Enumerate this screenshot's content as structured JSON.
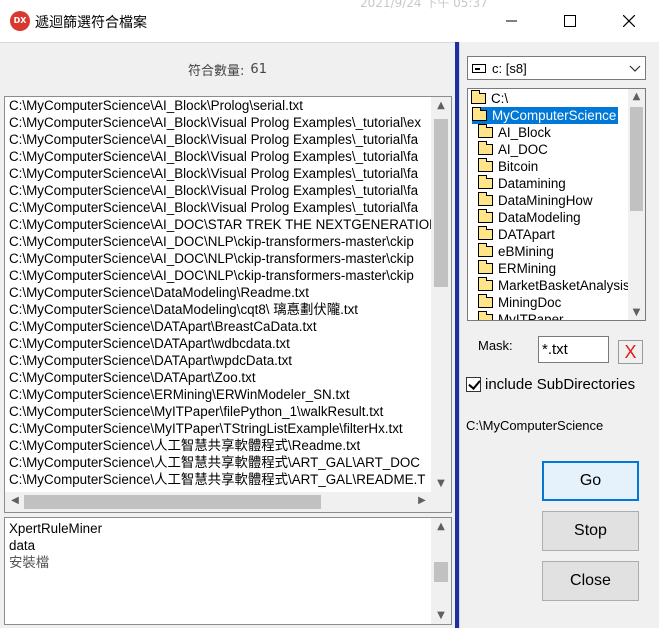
{
  "window": {
    "app_icon_text": "DX",
    "title": "遞迴篩選符合檔案",
    "background_text": "2021/9/24 下午 05:37",
    "minimize_label": "—",
    "maximize_label": "☐",
    "close_label": "✕"
  },
  "results": {
    "count_label": "符合數量:",
    "count_value": "61",
    "files": [
      "C:\\MyComputerScience\\AI_Block\\Prolog\\serial.txt",
      "C:\\MyComputerScience\\AI_Block\\Visual Prolog Examples\\_tutorial\\ex",
      "C:\\MyComputerScience\\AI_Block\\Visual Prolog Examples\\_tutorial\\fa",
      "C:\\MyComputerScience\\AI_Block\\Visual Prolog Examples\\_tutorial\\fa",
      "C:\\MyComputerScience\\AI_Block\\Visual Prolog Examples\\_tutorial\\fa",
      "C:\\MyComputerScience\\AI_Block\\Visual Prolog Examples\\_tutorial\\fa",
      "C:\\MyComputerScience\\AI_Block\\Visual Prolog Examples\\_tutorial\\fa",
      "C:\\MyComputerScience\\AI_DOC\\STAR TREK THE NEXTGENERATION",
      "C:\\MyComputerScience\\AI_DOC\\NLP\\ckip-transformers-master\\ckip",
      "C:\\MyComputerScience\\AI_DOC\\NLP\\ckip-transformers-master\\ckip",
      "C:\\MyComputerScience\\AI_DOC\\NLP\\ckip-transformers-master\\ckip",
      "C:\\MyComputerScience\\DataModeling\\Readme.txt",
      "C:\\MyComputerScience\\DataModeling\\cqt8\\   璃惪劃伏隴.txt",
      "C:\\MyComputerScience\\DATApart\\BreastCaData.txt",
      "C:\\MyComputerScience\\DATApart\\wdbcdata.txt",
      "C:\\MyComputerScience\\DATApart\\wpdcData.txt",
      "C:\\MyComputerScience\\DATApart\\Zoo.txt",
      "C:\\MyComputerScience\\ERMining\\ERWinModeler_SN.txt",
      "C:\\MyComputerScience\\MyITPaper\\filePython_1\\walkResult.txt",
      "C:\\MyComputerScience\\MyITPaper\\TStringListExample\\filterHx.txt",
      "C:\\MyComputerScience\\人工智慧共享軟體程式\\Readme.txt",
      "C:\\MyComputerScience\\人工智慧共享軟體程式\\ART_GAL\\ART_DOC",
      "C:\\MyComputerScience\\人工智慧共享軟體程式\\ART_GAL\\README.T"
    ]
  },
  "memo": {
    "lines": [
      "XpertRuleMiner",
      "data",
      "安裝檔"
    ]
  },
  "drive": {
    "selected": "c: [s8]"
  },
  "directories": {
    "root": "C:\\",
    "selected": "MyComputerScience",
    "children": [
      "AI_Block",
      "AI_DOC",
      "Bitcoin",
      "Datamining",
      "DataMiningHow",
      "DataModeling",
      "DATApart",
      "eBMining",
      "ERMining",
      "MarketBasketAnalysis",
      "MiningDoc",
      "MyITPaper"
    ]
  },
  "mask": {
    "label": "Mask:",
    "value": "*.txt",
    "clear_label": "X"
  },
  "options": {
    "include_subdirs_label": "include SubDirectories",
    "include_subdirs_checked": true
  },
  "current_path": "C:\\MyComputerScience",
  "buttons": {
    "go": "Go",
    "stop": "Stop",
    "close": "Close"
  },
  "colors": {
    "splitter": "#1c2fa3",
    "selection": "#0078d7",
    "clear_x": "#e21a1a"
  }
}
